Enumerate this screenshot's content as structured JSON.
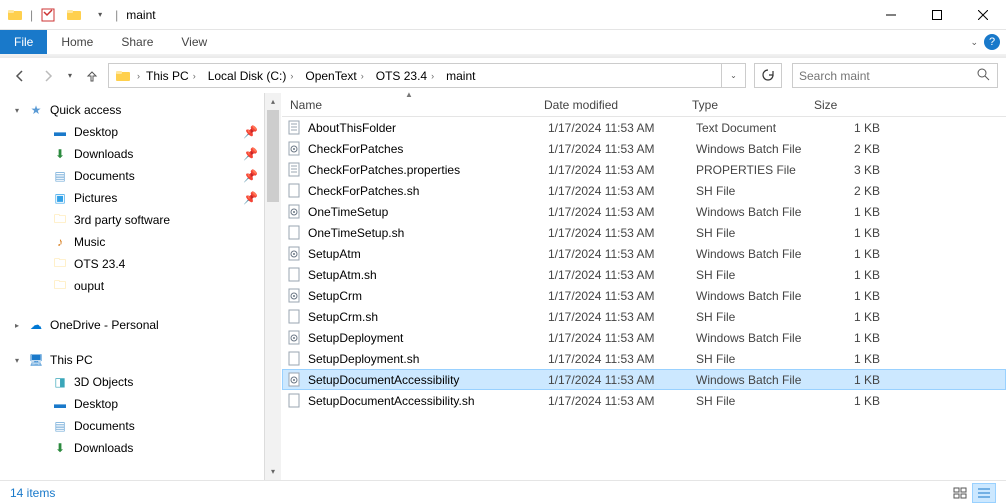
{
  "window": {
    "title": "maint"
  },
  "tabs": {
    "file": "File",
    "home": "Home",
    "share": "Share",
    "view": "View"
  },
  "breadcrumb": {
    "items": [
      "This PC",
      "Local Disk (C:)",
      "OpenText",
      "OTS 23.4",
      "maint"
    ]
  },
  "search": {
    "placeholder": "Search maint"
  },
  "nav": {
    "quick_access": "Quick access",
    "desktop": "Desktop",
    "downloads": "Downloads",
    "documents": "Documents",
    "pictures": "Pictures",
    "third_party": "3rd party software",
    "music": "Music",
    "ots": "OTS 23.4",
    "ouput": "ouput",
    "onedrive": "OneDrive - Personal",
    "this_pc": "This PC",
    "td_objects": "3D Objects",
    "desktop2": "Desktop",
    "documents2": "Documents",
    "downloads2": "Downloads"
  },
  "columns": {
    "name": "Name",
    "date": "Date modified",
    "type": "Type",
    "size": "Size"
  },
  "files": [
    {
      "name": "AboutThisFolder",
      "date": "1/17/2024 11:53 AM",
      "type": "Text Document",
      "size": "1 KB",
      "icon": "txt"
    },
    {
      "name": "CheckForPatches",
      "date": "1/17/2024 11:53 AM",
      "type": "Windows Batch File",
      "size": "2 KB",
      "icon": "bat"
    },
    {
      "name": "CheckForPatches.properties",
      "date": "1/17/2024 11:53 AM",
      "type": "PROPERTIES File",
      "size": "3 KB",
      "icon": "txt"
    },
    {
      "name": "CheckForPatches.sh",
      "date": "1/17/2024 11:53 AM",
      "type": "SH File",
      "size": "2 KB",
      "icon": "file"
    },
    {
      "name": "OneTimeSetup",
      "date": "1/17/2024 11:53 AM",
      "type": "Windows Batch File",
      "size": "1 KB",
      "icon": "bat"
    },
    {
      "name": "OneTimeSetup.sh",
      "date": "1/17/2024 11:53 AM",
      "type": "SH File",
      "size": "1 KB",
      "icon": "file"
    },
    {
      "name": "SetupAtm",
      "date": "1/17/2024 11:53 AM",
      "type": "Windows Batch File",
      "size": "1 KB",
      "icon": "bat"
    },
    {
      "name": "SetupAtm.sh",
      "date": "1/17/2024 11:53 AM",
      "type": "SH File",
      "size": "1 KB",
      "icon": "file"
    },
    {
      "name": "SetupCrm",
      "date": "1/17/2024 11:53 AM",
      "type": "Windows Batch File",
      "size": "1 KB",
      "icon": "bat"
    },
    {
      "name": "SetupCrm.sh",
      "date": "1/17/2024 11:53 AM",
      "type": "SH File",
      "size": "1 KB",
      "icon": "file"
    },
    {
      "name": "SetupDeployment",
      "date": "1/17/2024 11:53 AM",
      "type": "Windows Batch File",
      "size": "1 KB",
      "icon": "bat"
    },
    {
      "name": "SetupDeployment.sh",
      "date": "1/17/2024 11:53 AM",
      "type": "SH File",
      "size": "1 KB",
      "icon": "file"
    },
    {
      "name": "SetupDocumentAccessibility",
      "date": "1/17/2024 11:53 AM",
      "type": "Windows Batch File",
      "size": "1 KB",
      "icon": "bat",
      "selected": true
    },
    {
      "name": "SetupDocumentAccessibility.sh",
      "date": "1/17/2024 11:53 AM",
      "type": "SH File",
      "size": "1 KB",
      "icon": "file"
    }
  ],
  "status": {
    "count": "14 items"
  }
}
